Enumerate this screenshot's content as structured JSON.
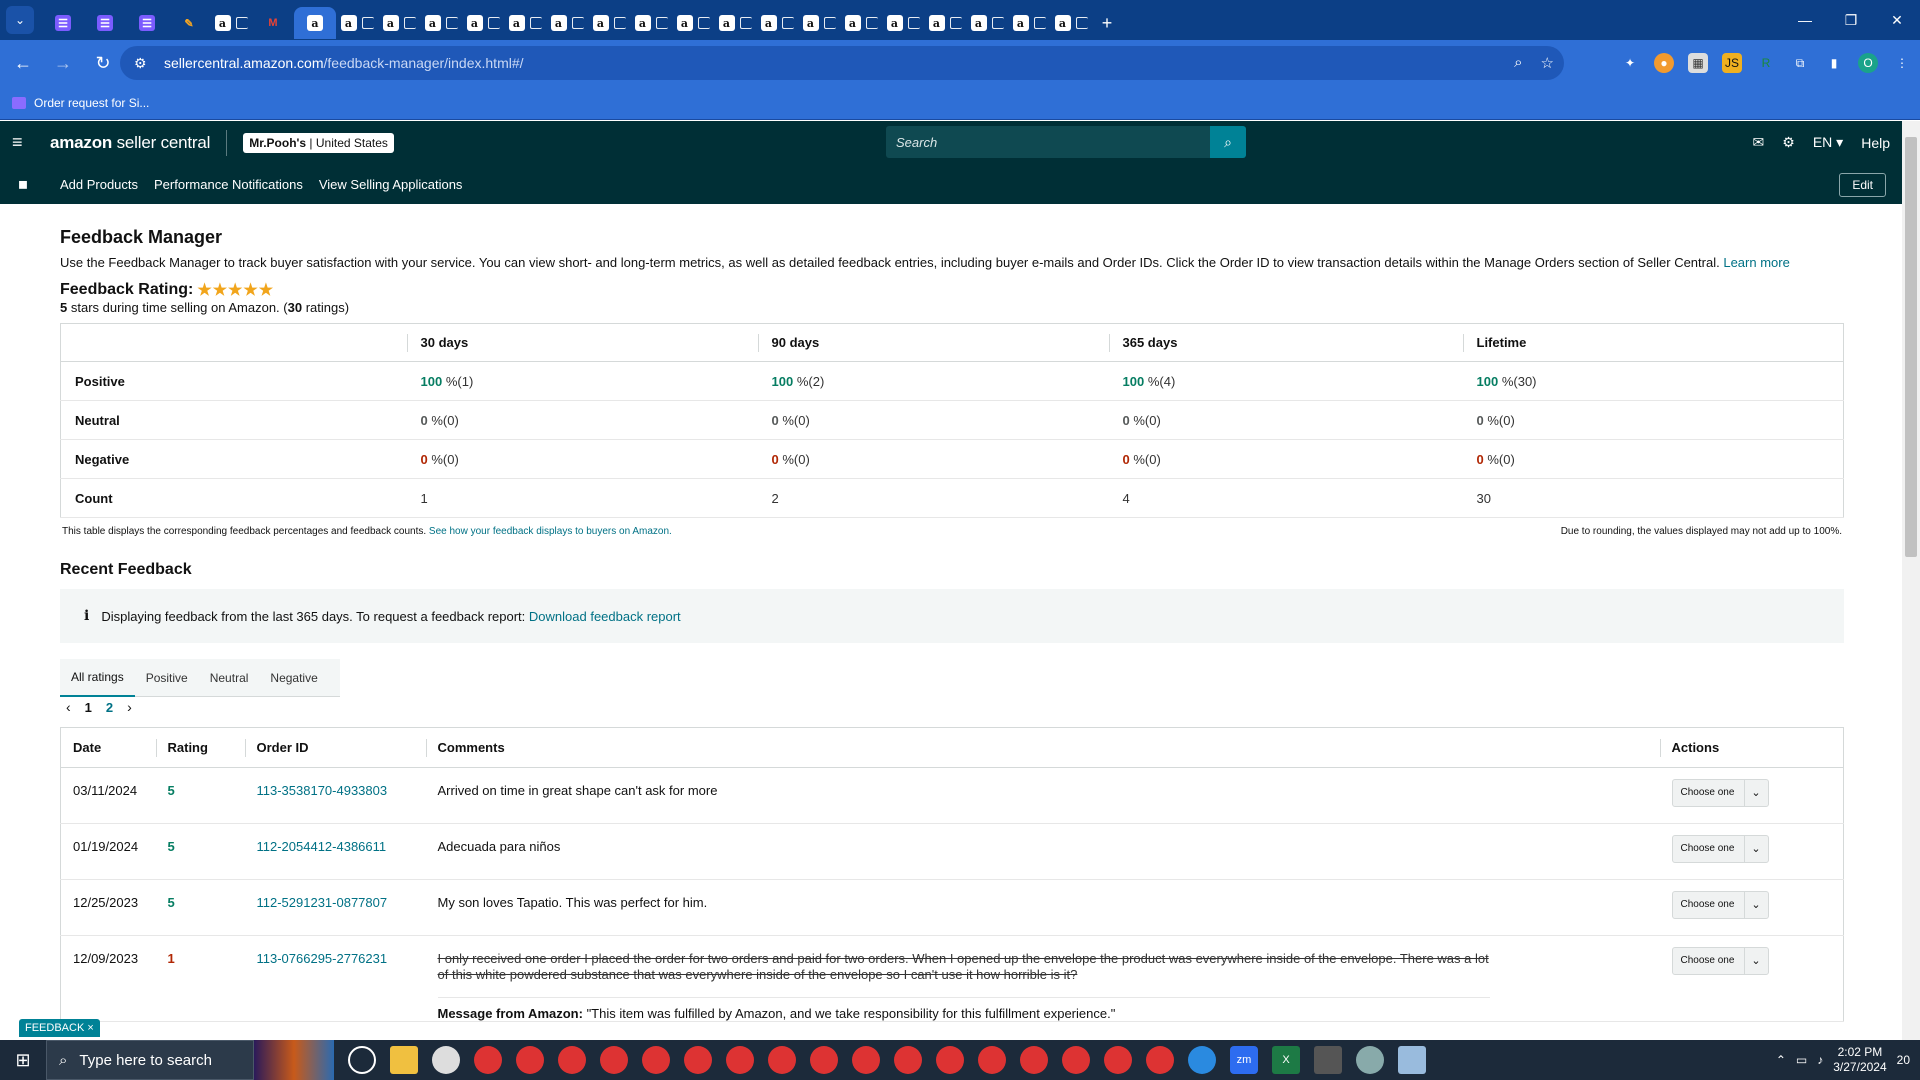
{
  "browser": {
    "tabs": [
      {
        "icon": "doc-icon",
        "label": ""
      },
      {
        "icon": "doc-icon",
        "label": ""
      },
      {
        "icon": "doc-icon",
        "label": ""
      },
      {
        "icon": "pen-icon",
        "label": ""
      },
      {
        "icon": "amazon-icon",
        "label": ""
      },
      {
        "icon": "gmail-icon",
        "label": ""
      },
      {
        "icon": "amazon-icon",
        "label": "",
        "active": true
      },
      {
        "icon": "amazon-icon",
        "label": ""
      },
      {
        "icon": "amazon-icon",
        "label": ""
      },
      {
        "icon": "amazon-icon",
        "label": ""
      },
      {
        "icon": "amazon-icon",
        "label": ""
      },
      {
        "icon": "amazon-icon",
        "label": ""
      },
      {
        "icon": "amazon-icon",
        "label": ""
      },
      {
        "icon": "amazon-icon",
        "label": ""
      },
      {
        "icon": "amazon-icon",
        "label": ""
      },
      {
        "icon": "amazon-icon",
        "label": ""
      },
      {
        "icon": "amazon-icon",
        "label": ""
      },
      {
        "icon": "amazon-icon",
        "label": ""
      },
      {
        "icon": "amazon-icon",
        "label": ""
      },
      {
        "icon": "amazon-icon",
        "label": ""
      },
      {
        "icon": "amazon-icon",
        "label": ""
      },
      {
        "icon": "amazon-icon",
        "label": ""
      },
      {
        "icon": "amazon-icon",
        "label": ""
      },
      {
        "icon": "amazon-icon",
        "label": ""
      },
      {
        "icon": "amazon-icon",
        "label": ""
      }
    ],
    "url_host": "sellercentral.amazon.com",
    "url_path": "/feedback-manager/index.html#/",
    "bookmark": "Order request for Si..."
  },
  "header": {
    "logo_main": "amazon",
    "logo_rest": " seller central",
    "account_name": "Mr.Pooh's",
    "account_region": " | United States",
    "search_placeholder": "Search",
    "language": "EN",
    "help": "Help"
  },
  "nav": {
    "items": [
      "Add Products",
      "Performance Notifications",
      "View Selling Applications"
    ],
    "edit": "Edit"
  },
  "page": {
    "title": "Feedback Manager",
    "description": "Use the Feedback Manager to track buyer satisfaction with your service. You can view short- and long-term metrics, as well as detailed feedback entries, including buyer e-mails and Order IDs. Click the Order ID to view transaction details within the Manage Orders section of Seller Central.",
    "learn_more": "Learn more",
    "rating_label": "Feedback Rating:",
    "stars": "★★★★★",
    "rating_stars_value": "5",
    "rating_sub_mid": " stars during time selling on Amazon. (",
    "rating_count": "30",
    "rating_sub_end": " ratings)"
  },
  "metrics": {
    "columns": [
      "30 days",
      "90 days",
      "365 days",
      "Lifetime"
    ],
    "rows": [
      {
        "label": "Positive",
        "type": "pos",
        "cells": [
          [
            "100",
            "%(1)"
          ],
          [
            "100",
            "%(2)"
          ],
          [
            "100",
            "%(4)"
          ],
          [
            "100",
            "%(30)"
          ]
        ]
      },
      {
        "label": "Neutral",
        "type": "neu",
        "cells": [
          [
            "0",
            "%(0)"
          ],
          [
            "0",
            "%(0)"
          ],
          [
            "0",
            "%(0)"
          ],
          [
            "0",
            "%(0)"
          ]
        ]
      },
      {
        "label": "Negative",
        "type": "neg",
        "cells": [
          [
            "0",
            "%(0)"
          ],
          [
            "0",
            "%(0)"
          ],
          [
            "0",
            "%(0)"
          ],
          [
            "0",
            "%(0)"
          ]
        ]
      },
      {
        "label": "Count",
        "type": "count",
        "cells": [
          [
            "1",
            ""
          ],
          [
            "2",
            ""
          ],
          [
            "4",
            ""
          ],
          [
            "30",
            ""
          ]
        ]
      }
    ],
    "note_left": "This table displays the corresponding feedback percentages and feedback counts.",
    "note_link": "See how your feedback displays to buyers on Amazon.",
    "note_right": "Due to rounding, the values displayed may not add up to 100%."
  },
  "recent": {
    "title": "Recent Feedback",
    "info_icon": "i",
    "info_text": "Displaying feedback from the last 365 days. To request a feedback report:",
    "info_link": "Download feedback report",
    "tabs": [
      "All ratings",
      "Positive",
      "Neutral",
      "Negative"
    ],
    "pages": [
      "1",
      "2"
    ],
    "columns": [
      "Date",
      "Rating",
      "Order ID",
      "Comments",
      "Actions"
    ],
    "action_label": "Choose one",
    "rows": [
      {
        "date": "03/11/2024",
        "rating": "5",
        "order": "113-3538170-4933803",
        "comment": "Arrived on time in great shape can't ask for more",
        "struck": false
      },
      {
        "date": "01/19/2024",
        "rating": "5",
        "order": "112-2054412-4386611",
        "comment": "Adecuada para niños",
        "struck": false
      },
      {
        "date": "12/25/2023",
        "rating": "5",
        "order": "112-5291231-0877807",
        "comment": "My son loves Tapatio. This was perfect for him.",
        "struck": false
      },
      {
        "date": "12/09/2023",
        "rating": "1",
        "order": "113-0766295-2776231",
        "comment": "I only received one order I placed the order for two orders and paid for two orders. When I opened up the envelope the product was everywhere inside of the envelope. There was a lot of this white powdered substance that was everywhere inside of the envelope so I can't use it how horrible is it?",
        "struck": true,
        "amazon_label": "Message from Amazon:",
        "amazon_message": "\"This item was fulfilled by Amazon, and we take responsibility for this fulfillment experience.\""
      }
    ]
  },
  "feedback_tag": "FEEDBACK ×",
  "taskbar": {
    "search_placeholder": "Type here to search",
    "time": "2:02 PM",
    "date": "3/27/2024",
    "notifications": "20"
  }
}
